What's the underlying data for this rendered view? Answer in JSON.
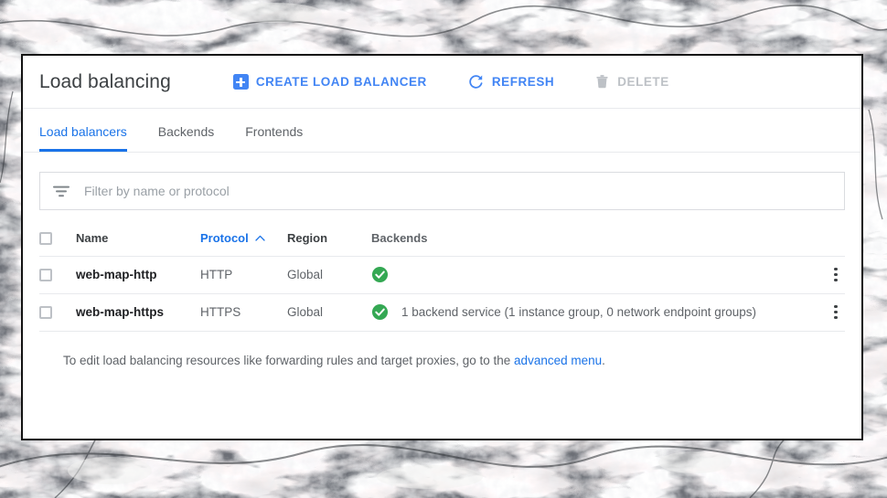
{
  "background": {
    "type": "marble-texture-photo"
  },
  "header": {
    "title": "Load balancing",
    "actions": [
      {
        "label": "CREATE LOAD BALANCER",
        "icon": "plus-square-icon",
        "state": "enabled"
      },
      {
        "label": "REFRESH",
        "icon": "refresh-icon",
        "state": "enabled"
      },
      {
        "label": "DELETE",
        "icon": "trash-icon",
        "state": "disabled"
      }
    ]
  },
  "tabs": [
    {
      "label": "Load balancers",
      "active": true
    },
    {
      "label": "Backends",
      "active": false
    },
    {
      "label": "Frontends",
      "active": false
    }
  ],
  "filter": {
    "icon": "filter-icon",
    "placeholder": "Filter by name or protocol",
    "value": ""
  },
  "table": {
    "columns": [
      {
        "key": "name",
        "label": "Name",
        "sorted": false
      },
      {
        "key": "protocol",
        "label": "Protocol",
        "sorted": true,
        "sort_direction": "asc"
      },
      {
        "key": "region",
        "label": "Region",
        "sorted": false
      },
      {
        "key": "backends",
        "label": "Backends",
        "sorted": false
      }
    ],
    "rows": [
      {
        "selected": false,
        "name": "web-map-http",
        "protocol": "HTTP",
        "region": "Global",
        "backend_status": "healthy",
        "backends": ""
      },
      {
        "selected": false,
        "name": "web-map-https",
        "protocol": "HTTPS",
        "region": "Global",
        "backend_status": "healthy",
        "backends": "1 backend service (1 instance group, 0 network endpoint groups)"
      }
    ]
  },
  "note": {
    "text": "To edit load balancing resources like forwarding rules and target proxies, go to the ",
    "link": "advanced menu",
    "suffix": "."
  },
  "colors": {
    "accent_blue": "#1a73e8",
    "action_blue": "#4285f4",
    "healthy_green": "#34a853",
    "disabled_gray": "#bdc1c6",
    "text_primary": "#202124",
    "text_secondary": "#5f6368"
  }
}
